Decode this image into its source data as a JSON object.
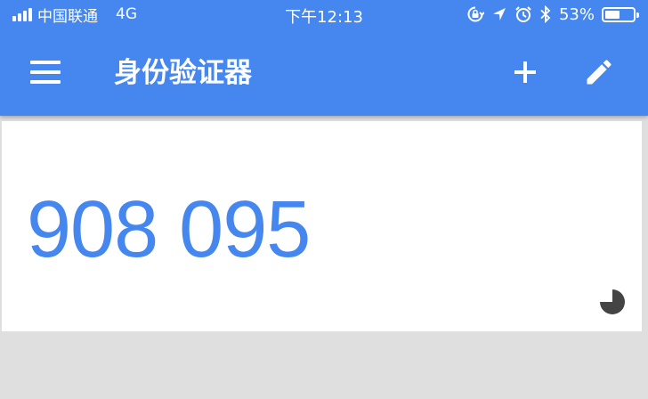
{
  "status_bar": {
    "carrier": "中国联通",
    "network": "4G",
    "time": "下午12:13",
    "battery_percent": "53%",
    "battery_level": 0.53,
    "icons": [
      "signal-icon",
      "rotation-lock-icon",
      "location-icon",
      "alarm-icon",
      "bluetooth-icon",
      "battery-icon"
    ]
  },
  "app_bar": {
    "title": "身份验证器",
    "icons": [
      "menu-icon",
      "add-icon",
      "edit-icon"
    ]
  },
  "account_card": {
    "code": "908 095",
    "countdown_icon": "timer-pie-icon",
    "countdown_remaining_fraction": 0.75
  },
  "colors": {
    "primary": "#4587ee",
    "card_background": "#ffffff",
    "page_background": "#dfdfdf",
    "timer": "#444444"
  }
}
